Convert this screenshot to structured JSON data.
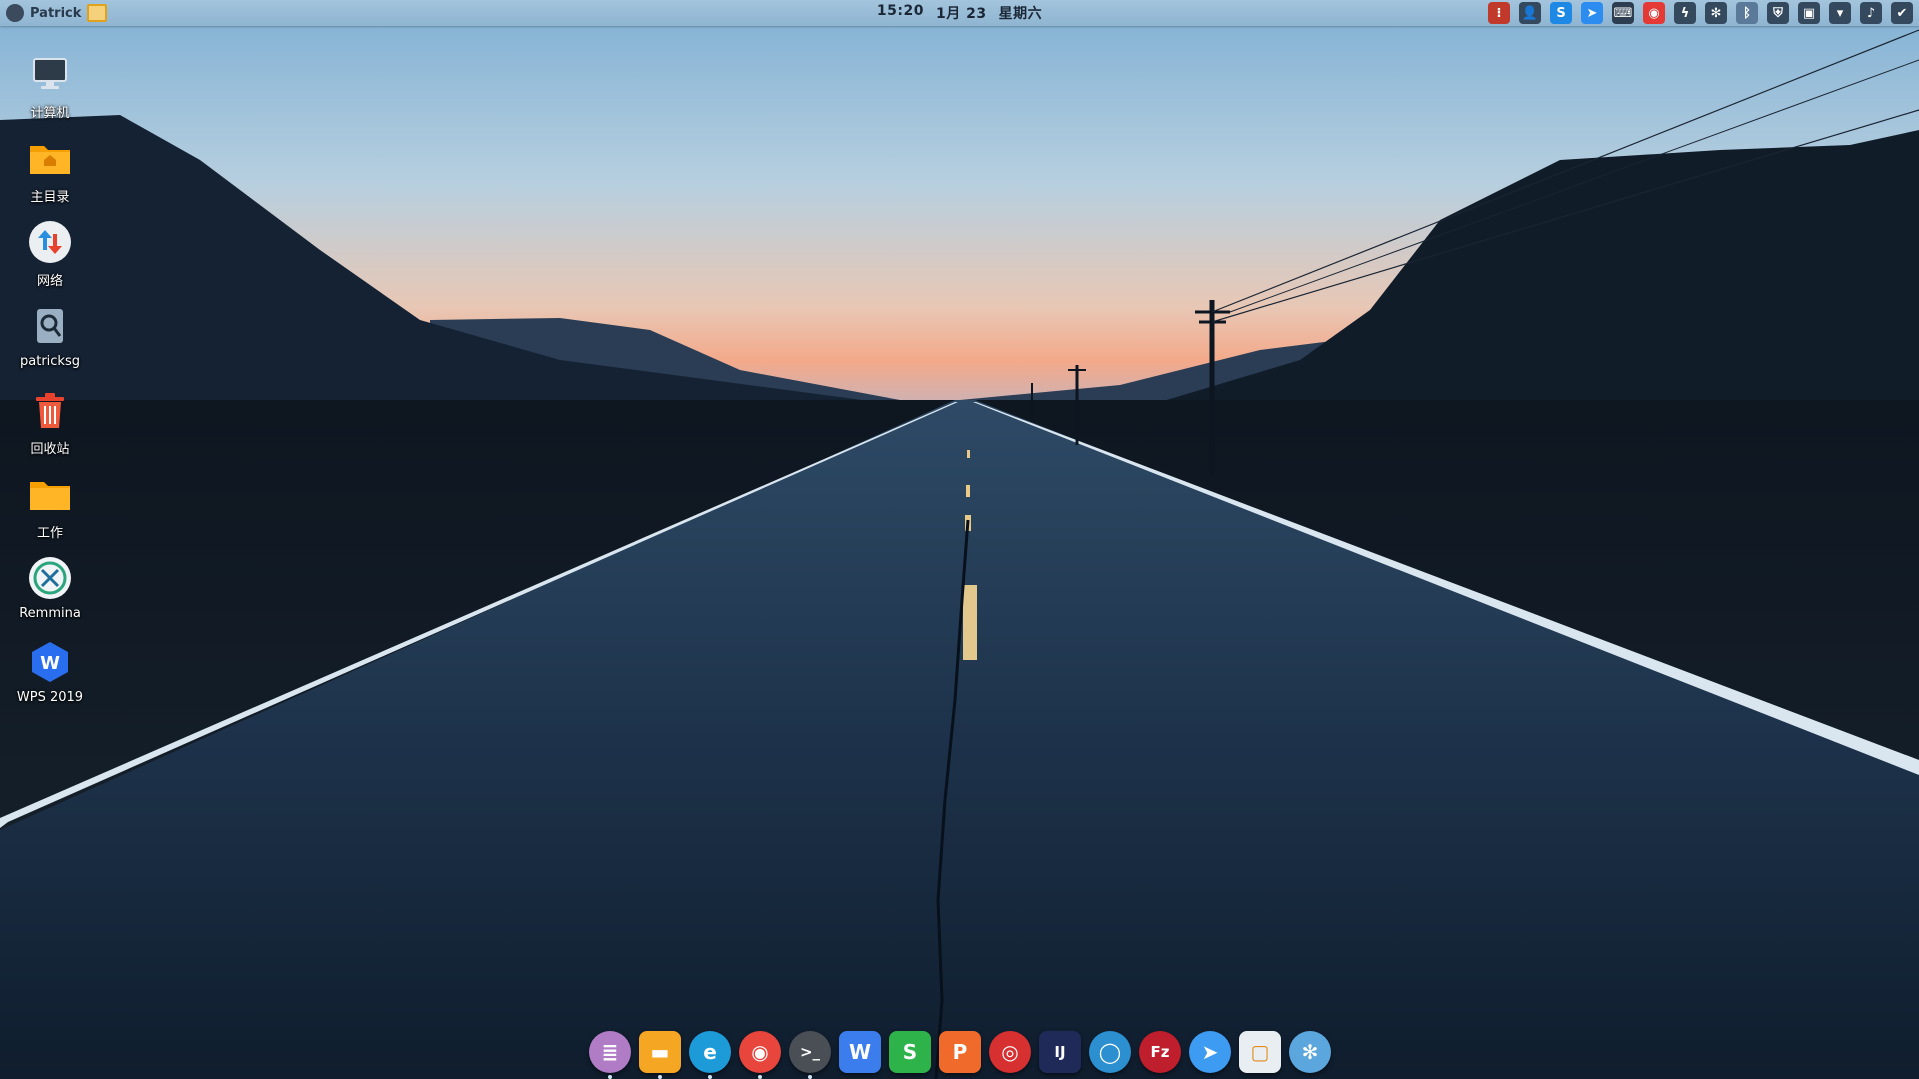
{
  "topbar": {
    "user_name": "Patrick",
    "time": "15:20",
    "date": "1月 23",
    "weekday": "星期六",
    "tray_icons": [
      {
        "name": "network-indicator-icon",
        "color": "#c0392b",
        "glyph": "⁝"
      },
      {
        "name": "user-account-icon",
        "color": "#34495e",
        "glyph": "👤"
      },
      {
        "name": "skype-icon",
        "color": "#1e88e5",
        "glyph": "S"
      },
      {
        "name": "feishu-tray-icon",
        "color": "#2d8cf0",
        "glyph": "➤"
      },
      {
        "name": "keyboard-layout-icon",
        "color": "#2c3e50",
        "glyph": "⌨"
      },
      {
        "name": "netease-music-tray-icon",
        "color": "#e53935",
        "glyph": "◉"
      },
      {
        "name": "bolt-icon",
        "color": "#34495e",
        "glyph": "ϟ"
      },
      {
        "name": "pinwheel-tray-icon",
        "color": "#34495e",
        "glyph": "✻"
      },
      {
        "name": "bluetooth-icon",
        "color": "#5b7a99",
        "glyph": "ᛒ"
      },
      {
        "name": "shield-icon",
        "color": "#34495e",
        "glyph": "⛨"
      },
      {
        "name": "screenshot-icon",
        "color": "#34495e",
        "glyph": "▣"
      },
      {
        "name": "wifi-icon",
        "color": "#34495e",
        "glyph": "▾"
      },
      {
        "name": "music-note-icon",
        "color": "#34495e",
        "glyph": "♪"
      },
      {
        "name": "check-icon",
        "color": "#34495e",
        "glyph": "✔"
      }
    ]
  },
  "desktop_icons": [
    {
      "name": "computer",
      "label": "计算机",
      "icon": "monitor-icon"
    },
    {
      "name": "home-folder",
      "label": "主目录",
      "icon": "home-folder-icon"
    },
    {
      "name": "network",
      "label": "网络",
      "icon": "network-arrows-icon"
    },
    {
      "name": "patricksg",
      "label": "patricksg",
      "icon": "search-file-icon"
    },
    {
      "name": "trash",
      "label": "回收站",
      "icon": "trash-icon"
    },
    {
      "name": "work-folder",
      "label": "工作",
      "icon": "folder-icon"
    },
    {
      "name": "remmina",
      "label": "Remmina",
      "icon": "remmina-icon"
    },
    {
      "name": "wps-2019",
      "label": "WPS 2019",
      "icon": "wps-icon"
    }
  ],
  "dock": [
    {
      "name": "text-editor",
      "glyph": "≣",
      "bg": "#b07cc6",
      "running": true
    },
    {
      "name": "files",
      "glyph": "▬",
      "bg": "#f5a623",
      "running": true
    },
    {
      "name": "edge-dev",
      "glyph": "e",
      "bg": "#1c9bd8",
      "running": true
    },
    {
      "name": "chrome",
      "glyph": "◉",
      "bg": "#e8453c",
      "running": true
    },
    {
      "name": "terminal",
      "glyph": ">_",
      "bg": "#4a4f55",
      "running": true
    },
    {
      "name": "wps-writer",
      "glyph": "W",
      "bg": "#3b7ded",
      "running": false
    },
    {
      "name": "wps-spreadsheet",
      "glyph": "S",
      "bg": "#2db34a",
      "running": false
    },
    {
      "name": "wps-presentation",
      "glyph": "P",
      "bg": "#f06a2b",
      "running": false
    },
    {
      "name": "netease-music",
      "glyph": "◎",
      "bg": "#d63030",
      "running": false
    },
    {
      "name": "intellij-idea",
      "glyph": "IJ",
      "bg": "#1f2a58",
      "running": false
    },
    {
      "name": "color-app",
      "glyph": "◯",
      "bg": "#2b8fd0",
      "running": false
    },
    {
      "name": "filezilla",
      "glyph": "Fz",
      "bg": "#bf1e2d",
      "running": false
    },
    {
      "name": "feishu",
      "glyph": "➤",
      "bg": "#3e9bf2",
      "running": false
    },
    {
      "name": "virtualbox",
      "glyph": "▢",
      "bg": "#e9eef3",
      "running": false
    },
    {
      "name": "pinwheel",
      "glyph": "✻",
      "bg": "#5ba6dc",
      "running": false
    }
  ]
}
